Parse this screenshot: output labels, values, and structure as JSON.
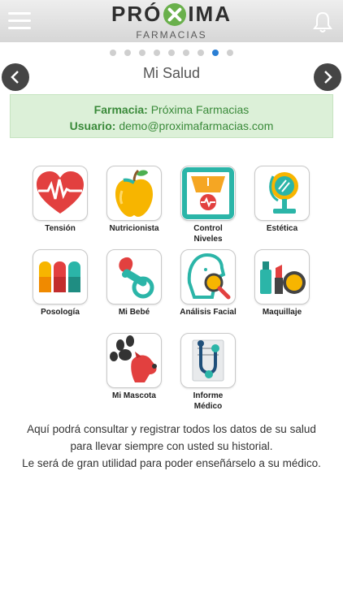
{
  "header": {
    "logo_main_left": "PRÓ",
    "logo_main_right": "IMA",
    "logo_sub": "FARMACIAS"
  },
  "pager": {
    "total": 9,
    "active_index": 7
  },
  "title": "Mi Salud",
  "info": {
    "pharmacy_label": "Farmacia:",
    "pharmacy_value": "Próxima Farmacias",
    "user_label": "Usuario:",
    "user_value": "demo@proximafarmacias.com"
  },
  "tiles": [
    {
      "label": "Tensión",
      "icon": "heart-pressure-icon"
    },
    {
      "label": "Nutricionista",
      "icon": "apple-icon"
    },
    {
      "label": "Control Niveles",
      "icon": "scale-icon"
    },
    {
      "label": "Estética",
      "icon": "mirror-icon"
    },
    {
      "label": "Posología",
      "icon": "pills-icon"
    },
    {
      "label": "Mi Bebé",
      "icon": "pacifier-icon"
    },
    {
      "label": "Análisis Facial",
      "icon": "face-magnifier-icon"
    },
    {
      "label": "Maquillaje",
      "icon": "makeup-icon"
    },
    {
      "label": "Mi Mascota",
      "icon": "pet-icon"
    },
    {
      "label": "Informe Médico",
      "icon": "stethoscope-report-icon"
    }
  ],
  "description": {
    "line1": "Aquí podrá consultar y registrar todos los datos de su salud",
    "line2": "para llevar siempre con usted su historial.",
    "line3": "Le será de gran utilidad para poder enseñárselo a su médico."
  },
  "colors": {
    "header_bg": "#d6d6d6",
    "info_bg": "#dcf0d8",
    "info_text": "#3a8a3a",
    "active_dot": "#2a7fd4",
    "nav_button": "#454545"
  }
}
